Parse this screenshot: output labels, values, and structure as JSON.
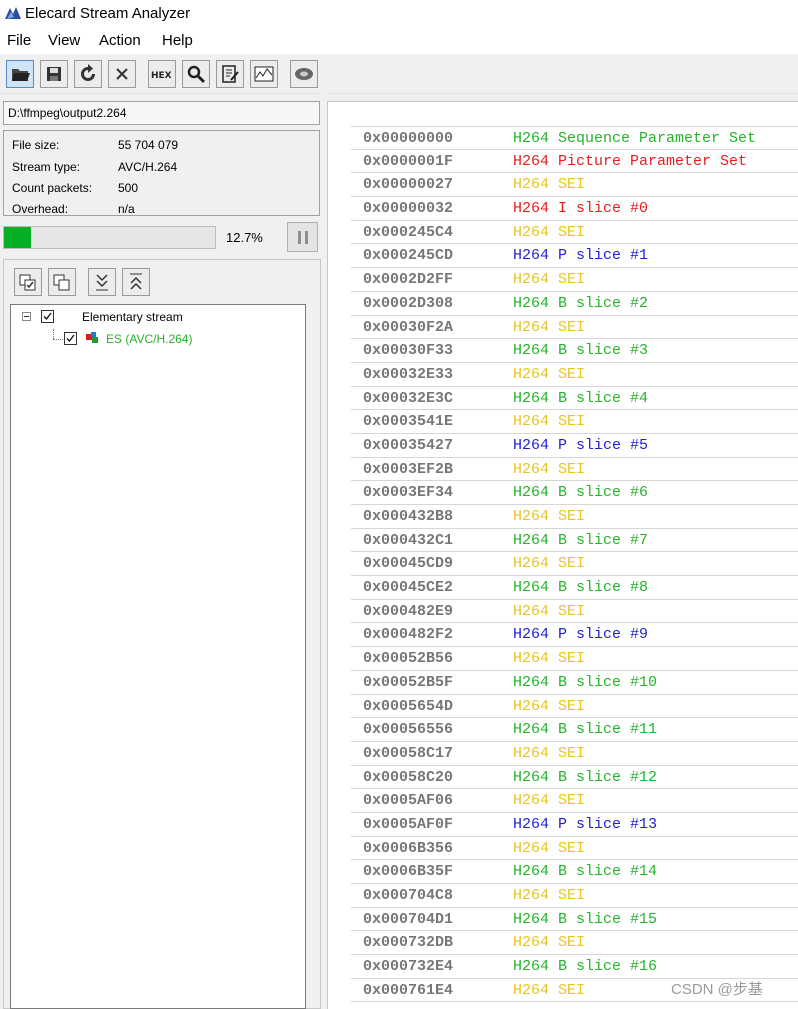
{
  "window": {
    "title": "Elecard Stream Analyzer"
  },
  "menu": [
    "File",
    "View",
    "Action",
    "Help"
  ],
  "path": "D:\\ffmpeg\\output2.264",
  "info": [
    {
      "label": "File size:",
      "value": "55 704 079"
    },
    {
      "label": "Stream type:",
      "value": "AVC/H.264"
    },
    {
      "label": "Count packets:",
      "value": "500"
    },
    {
      "label": "Overhead:",
      "value": "n/a"
    }
  ],
  "progress": {
    "percent": 12.7,
    "text": "12.7%"
  },
  "tree": {
    "root": "Elementary stream",
    "child": "ES (AVC/H.264)"
  },
  "colors": {
    "green": "#26b32c",
    "red": "#e81e1e",
    "yellow": "#e8c520",
    "blue": "#1f1fd8",
    "progress": "#06b025"
  },
  "packets": [
    {
      "addr": "0x00000000",
      "desc": "H264 Sequence Parameter Set",
      "color": "green"
    },
    {
      "addr": "0x0000001F",
      "desc": "H264 Picture Parameter Set",
      "color": "red"
    },
    {
      "addr": "0x00000027",
      "desc": "H264 SEI",
      "color": "yellow"
    },
    {
      "addr": "0x00000032",
      "desc": "H264 I slice #0",
      "color": "red"
    },
    {
      "addr": "0x000245C4",
      "desc": "H264 SEI",
      "color": "yellow"
    },
    {
      "addr": "0x000245CD",
      "desc": "H264 P slice #1",
      "color": "blue"
    },
    {
      "addr": "0x0002D2FF",
      "desc": "H264 SEI",
      "color": "yellow"
    },
    {
      "addr": "0x0002D308",
      "desc": "H264 B slice #2",
      "color": "green"
    },
    {
      "addr": "0x00030F2A",
      "desc": "H264 SEI",
      "color": "yellow"
    },
    {
      "addr": "0x00030F33",
      "desc": "H264 B slice #3",
      "color": "green"
    },
    {
      "addr": "0x00032E33",
      "desc": "H264 SEI",
      "color": "yellow"
    },
    {
      "addr": "0x00032E3C",
      "desc": "H264 B slice #4",
      "color": "green"
    },
    {
      "addr": "0x0003541E",
      "desc": "H264 SEI",
      "color": "yellow"
    },
    {
      "addr": "0x00035427",
      "desc": "H264 P slice #5",
      "color": "blue"
    },
    {
      "addr": "0x0003EF2B",
      "desc": "H264 SEI",
      "color": "yellow"
    },
    {
      "addr": "0x0003EF34",
      "desc": "H264 B slice #6",
      "color": "green"
    },
    {
      "addr": "0x000432B8",
      "desc": "H264 SEI",
      "color": "yellow"
    },
    {
      "addr": "0x000432C1",
      "desc": "H264 B slice #7",
      "color": "green"
    },
    {
      "addr": "0x00045CD9",
      "desc": "H264 SEI",
      "color": "yellow"
    },
    {
      "addr": "0x00045CE2",
      "desc": "H264 B slice #8",
      "color": "green"
    },
    {
      "addr": "0x000482E9",
      "desc": "H264 SEI",
      "color": "yellow"
    },
    {
      "addr": "0x000482F2",
      "desc": "H264 P slice #9",
      "color": "blue"
    },
    {
      "addr": "0x00052B56",
      "desc": "H264 SEI",
      "color": "yellow"
    },
    {
      "addr": "0x00052B5F",
      "desc": "H264 B slice #10",
      "color": "green"
    },
    {
      "addr": "0x0005654D",
      "desc": "H264 SEI",
      "color": "yellow"
    },
    {
      "addr": "0x00056556",
      "desc": "H264 B slice #11",
      "color": "green"
    },
    {
      "addr": "0x00058C17",
      "desc": "H264 SEI",
      "color": "yellow"
    },
    {
      "addr": "0x00058C20",
      "desc": "H264 B slice #12",
      "color": "green"
    },
    {
      "addr": "0x0005AF06",
      "desc": "H264 SEI",
      "color": "yellow"
    },
    {
      "addr": "0x0005AF0F",
      "desc": "H264 P slice #13",
      "color": "blue"
    },
    {
      "addr": "0x0006B356",
      "desc": "H264 SEI",
      "color": "yellow"
    },
    {
      "addr": "0x0006B35F",
      "desc": "H264 B slice #14",
      "color": "green"
    },
    {
      "addr": "0x000704C8",
      "desc": "H264 SEI",
      "color": "yellow"
    },
    {
      "addr": "0x000704D1",
      "desc": "H264 B slice #15",
      "color": "green"
    },
    {
      "addr": "0x000732DB",
      "desc": "H264 SEI",
      "color": "yellow"
    },
    {
      "addr": "0x000732E4",
      "desc": "H264 B slice #16",
      "color": "green"
    },
    {
      "addr": "0x000761E4",
      "desc": "H264 SEI",
      "color": "yellow"
    }
  ],
  "watermark": "CSDN @步基"
}
